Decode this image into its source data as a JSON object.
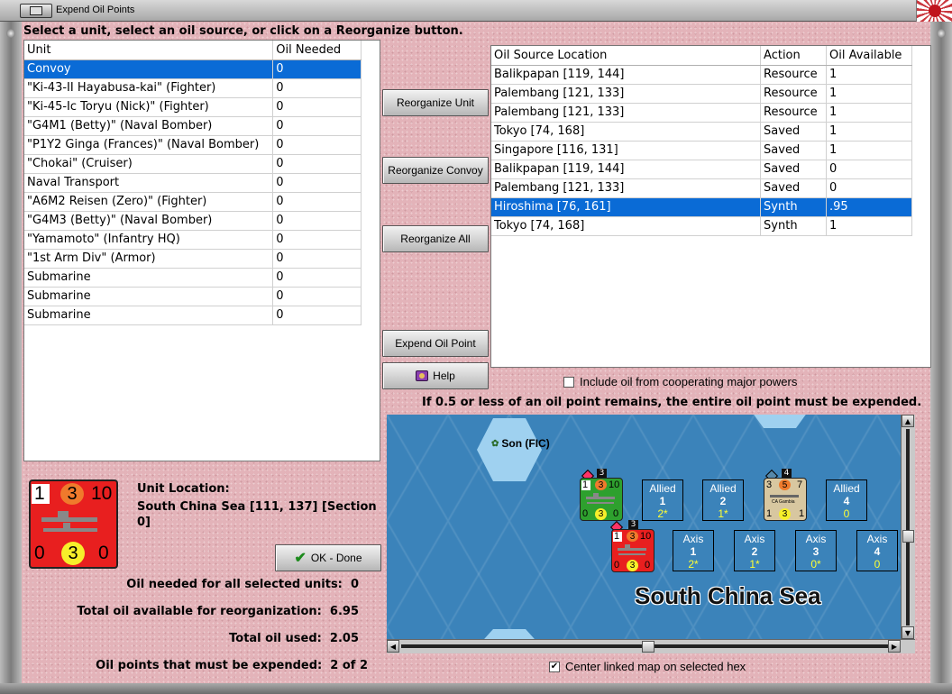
{
  "window": {
    "title": "Expend Oil Points"
  },
  "instruction": "Select a unit, select an oil source, or click on a Reorganize button.",
  "units_table": {
    "headers": [
      "Unit",
      "Oil Needed"
    ],
    "rows": [
      [
        "Convoy",
        "0"
      ],
      [
        "\"Ki-43-II Hayabusa-kai\" (Fighter)",
        "0"
      ],
      [
        "\"Ki-45-Ic Toryu (Nick)\" (Fighter)",
        "0"
      ],
      [
        "\"G4M1 (Betty)\" (Naval Bomber)",
        "0"
      ],
      [
        "\"P1Y2 Ginga (Frances)\" (Naval Bomber)",
        "0"
      ],
      [
        "\"Chokai\" (Cruiser)",
        "0"
      ],
      [
        "Naval Transport",
        "0"
      ],
      [
        "\"A6M2 Reisen (Zero)\" (Fighter)",
        "0"
      ],
      [
        "\"G4M3 (Betty)\" (Naval Bomber)",
        "0"
      ],
      [
        "\"Yamamoto\" (Infantry HQ)",
        "0"
      ],
      [
        "\"1st Arm Div\" (Armor)",
        "0"
      ],
      [
        "Submarine",
        "0"
      ],
      [
        "Submarine",
        "0"
      ],
      [
        "Submarine",
        "0"
      ]
    ],
    "selected_row": 0
  },
  "buttons": {
    "reorganize_unit": "Reorganize Unit",
    "reorganize_convoy": "Reorganize Convoy",
    "reorganize_all": "Reorganize All",
    "expend_oil_point": "Expend Oil Point",
    "help": "Help",
    "ok_done": "OK - Done"
  },
  "oil_table": {
    "headers": [
      "Oil Source Location",
      "Action",
      "Oil Available"
    ],
    "rows": [
      [
        "Balikpapan [119, 144]",
        "Resource",
        "1"
      ],
      [
        "Palembang [121, 133]",
        "Resource",
        "1"
      ],
      [
        "Palembang [121, 133]",
        "Resource",
        "1"
      ],
      [
        "Tokyo [74, 168]",
        "Saved",
        "1"
      ],
      [
        "Singapore [116, 131]",
        "Saved",
        "1"
      ],
      [
        "Balikpapan [119, 144]",
        "Saved",
        "0"
      ],
      [
        "Palembang [121, 133]",
        "Saved",
        "0"
      ],
      [
        "Hiroshima [76, 161]",
        "Synth",
        ".95"
      ],
      [
        "Tokyo [74, 168]",
        "Synth",
        "1"
      ]
    ],
    "selected_row": 7
  },
  "include_oil_label": "Include oil from cooperating major powers",
  "include_oil_checked": false,
  "oil_rule_note": "If 0.5 or less of an oil point remains, the entire oil point must be expended.",
  "unit_counter": {
    "top_left": "1",
    "top_mid": "3",
    "top_right": "10",
    "bot_left": "0",
    "bot_mid": "3",
    "bot_right": "0"
  },
  "unit_location": {
    "label": "Unit Location:",
    "value": "South China Sea [111, 137] [Section 0]"
  },
  "stats": [
    {
      "label": "Oil needed for all selected units:",
      "value": "0"
    },
    {
      "label": "Total oil available for reorganization:",
      "value": "6.95"
    },
    {
      "label": "Total oil used:",
      "value": "2.05"
    },
    {
      "label": "Oil points that must be expended:",
      "value": "2 of 2"
    }
  ],
  "map": {
    "place_label": "Son (FIC)",
    "sea_label": "South China Sea",
    "allied_slots": [
      {
        "title": "Allied",
        "num": "1",
        "val": "2*"
      },
      {
        "title": "Allied",
        "num": "2",
        "val": "1*"
      },
      {
        "title": "Allied",
        "num": "4",
        "val": "0"
      }
    ],
    "axis_slots": [
      {
        "title": "Axis",
        "num": "1",
        "val": "2*"
      },
      {
        "title": "Axis",
        "num": "2",
        "val": "1*"
      },
      {
        "title": "Axis",
        "num": "3",
        "val": "0*"
      },
      {
        "title": "Axis",
        "num": "4",
        "val": "0"
      }
    ],
    "green_counter": {
      "stack": "3",
      "tl": "1",
      "tm": "3",
      "tr": "10",
      "bl": "0",
      "bm": "3",
      "br": "0"
    },
    "tan_counter": {
      "stack": "4",
      "tl": "3",
      "tm": "5",
      "tr": "7",
      "name": "CA Gambia",
      "bl": "1",
      "bm": "3",
      "br": "1"
    },
    "red_counter": {
      "stack": "3",
      "tl": "1",
      "tm": "3",
      "tr": "10",
      "bl": "0",
      "bm": "3",
      "br": "0"
    }
  },
  "center_map_label": "Center linked map on selected hex",
  "center_map_checked": true
}
